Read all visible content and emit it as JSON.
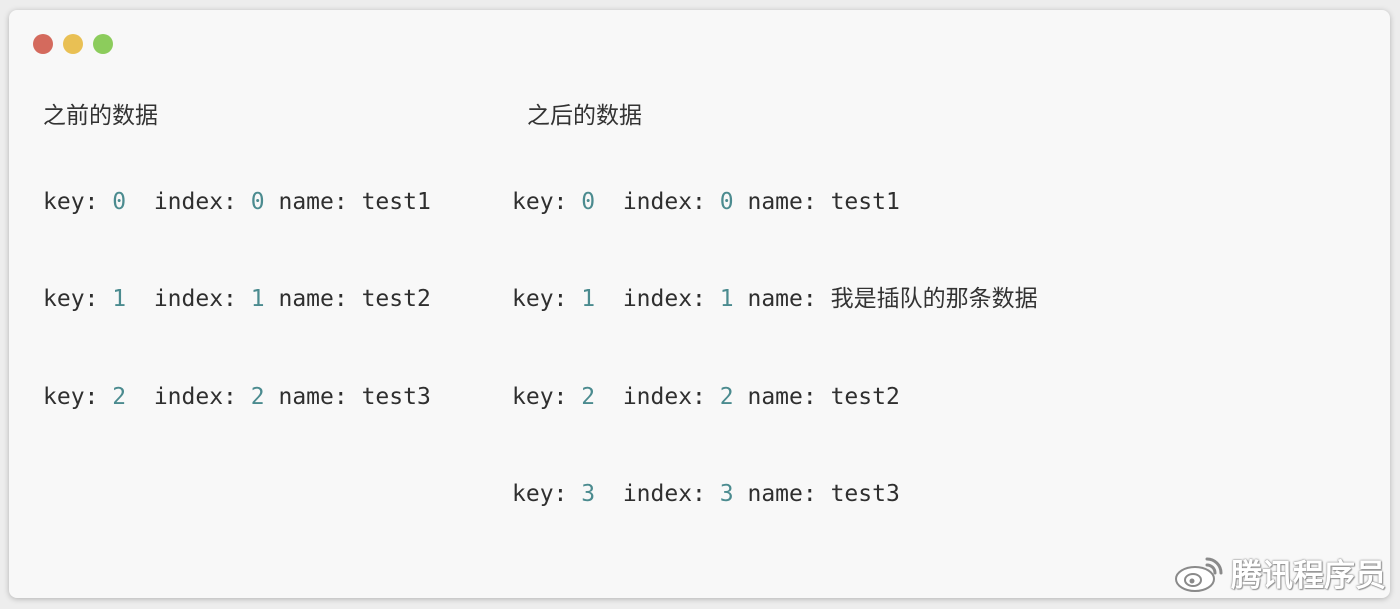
{
  "headings": {
    "before": "之前的数据",
    "after": "之后的数据"
  },
  "labels": {
    "key": "key: ",
    "index": "index: ",
    "name": "name: "
  },
  "before_rows": [
    {
      "key": "0",
      "index": "0",
      "name": "test1"
    },
    {
      "key": "1",
      "index": "1",
      "name": "test2"
    },
    {
      "key": "2",
      "index": "2",
      "name": "test3"
    }
  ],
  "after_rows": [
    {
      "key": "0",
      "index": "0",
      "name": "test1"
    },
    {
      "key": "1",
      "index": "1",
      "name": "我是插队的那条数据"
    },
    {
      "key": "2",
      "index": "2",
      "name": "test2"
    },
    {
      "key": "3",
      "index": "3",
      "name": "test3"
    }
  ],
  "watermark": {
    "icon": "weibo-icon",
    "text": "腾讯程序员"
  },
  "colors": {
    "number": "#4b8b8f",
    "traffic_red": "#d46a5d",
    "traffic_yellow": "#e9c054",
    "traffic_green": "#8ccc5c"
  }
}
